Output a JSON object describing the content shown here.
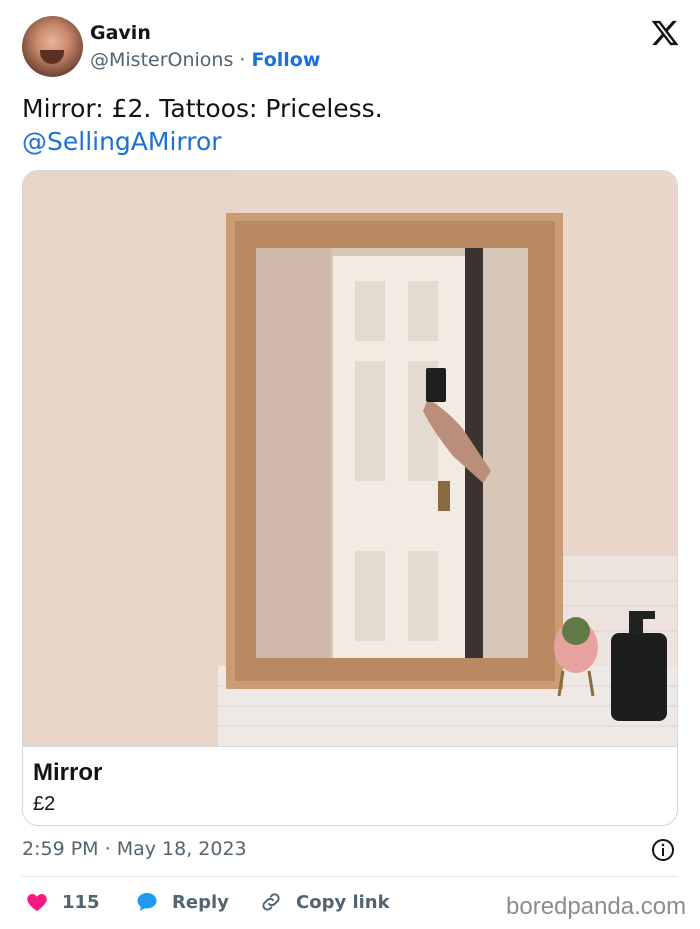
{
  "author": {
    "name": "Gavin",
    "handle": "@MisterOnions",
    "separator": "·",
    "follow_label": "Follow"
  },
  "tweet": {
    "text": "Mirror: £2. Tattoos: Priceless.",
    "mention": "@SellingAMirror"
  },
  "card": {
    "image_description": "photo of a gold-framed wall mirror reflecting a white door and a tattooed arm holding a phone",
    "title": "Mirror",
    "price": "£2"
  },
  "meta": {
    "time": "2:59 PM",
    "separator": "·",
    "date": "May 18, 2023"
  },
  "actions": {
    "likes_count": "115",
    "reply_label": "Reply",
    "copy_link_label": "Copy link"
  },
  "watermark": "boredpanda.com",
  "colors": {
    "link_blue": "#1d70d6",
    "like_red": "#f91880",
    "reply_blue": "#1d9bf0",
    "secondary_text": "#536471"
  },
  "icons": [
    "x-logo-icon",
    "heart-icon",
    "reply-bubble-icon",
    "link-icon",
    "info-icon"
  ]
}
